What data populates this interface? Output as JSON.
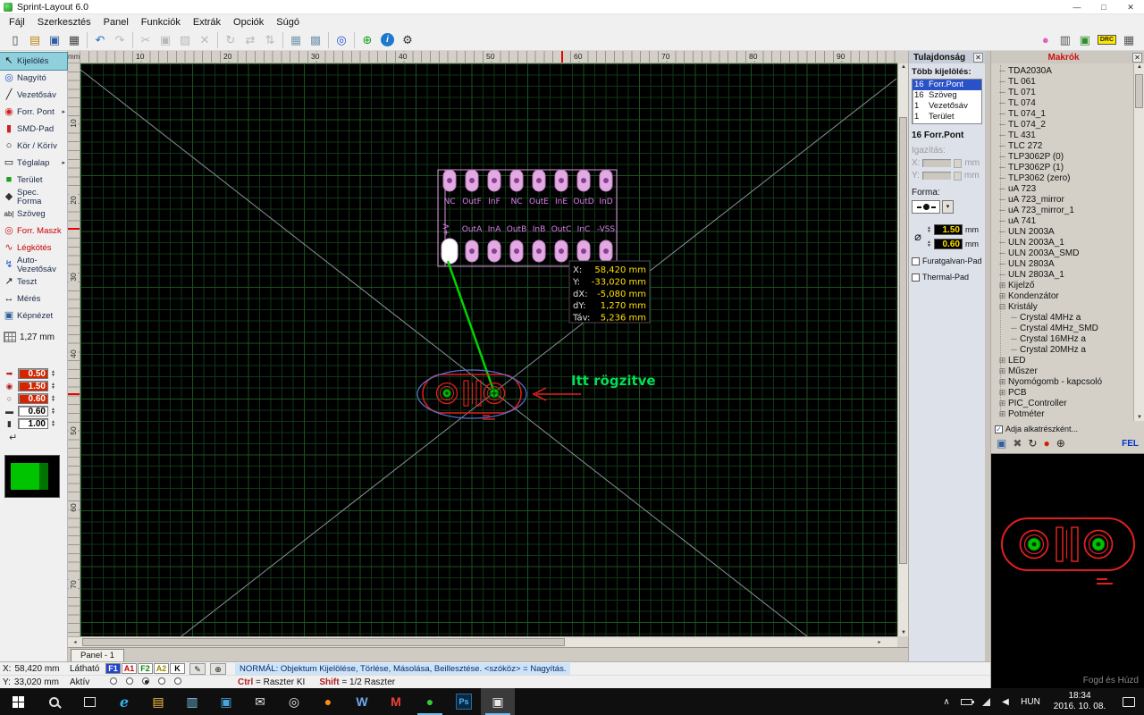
{
  "window": {
    "title": "Sprint-Layout 6.0",
    "minimize_glyph": "—",
    "maximize_glyph": "□",
    "close_glyph": "✕"
  },
  "menubar": [
    "Fájl",
    "Szerkesztés",
    "Panel",
    "Funkciók",
    "Extrák",
    "Opciók",
    "Súgó"
  ],
  "toolbar": {
    "left": [
      {
        "name": "new-file-icon",
        "glyph": "▯",
        "color": "#444444"
      },
      {
        "name": "open-folder-icon",
        "glyph": "▤",
        "color": "#c08a1a"
      },
      {
        "name": "save-icon",
        "glyph": "▣",
        "color": "#2f5fa0"
      },
      {
        "name": "print-icon",
        "glyph": "▦",
        "color": "#444444"
      },
      {
        "sep": true
      },
      {
        "name": "undo-icon",
        "glyph": "↶",
        "color": "#2a6fbd"
      },
      {
        "name": "redo-icon",
        "glyph": "↷",
        "color": "#b8b8b8"
      },
      {
        "sep": true
      },
      {
        "name": "cut-icon",
        "glyph": "✂",
        "color": "#b8b8b8"
      },
      {
        "name": "copy-icon",
        "glyph": "▣",
        "color": "#b8b8b8"
      },
      {
        "name": "paste-icon",
        "glyph": "▨",
        "color": "#b8b8b8"
      },
      {
        "name": "delete-icon",
        "glyph": "✕",
        "color": "#b8b8b8"
      },
      {
        "sep": true
      },
      {
        "name": "rotate-icon",
        "glyph": "↻",
        "color": "#b8b8b8"
      },
      {
        "name": "mirror-horizontal-icon",
        "glyph": "⇄",
        "color": "#b8b8b8"
      },
      {
        "name": "mirror-vertical-icon",
        "glyph": "⇅",
        "color": "#b8b8b8"
      },
      {
        "sep": true
      },
      {
        "name": "align-grid-icon",
        "glyph": "▦",
        "color": "#7a9ab0"
      },
      {
        "name": "snap-grid-icon",
        "glyph": "▩",
        "color": "#7a9ab0"
      },
      {
        "sep": true
      },
      {
        "name": "zoom-icon",
        "glyph": "◎",
        "color": "#2255cc"
      },
      {
        "sep": true
      },
      {
        "name": "crosshair-icon",
        "glyph": "⊕",
        "color": "#18a018"
      },
      {
        "name": "info-icon",
        "glyph": "i",
        "info": true
      },
      {
        "name": "gear-icon",
        "glyph": "⚙",
        "color": "#333333"
      }
    ],
    "right": [
      {
        "name": "hotkeys-icon",
        "glyph": "●",
        "color": "#e060c0"
      },
      {
        "name": "layer-pair-icon",
        "glyph": "▥",
        "color": "#555555"
      },
      {
        "name": "photo-view-icon",
        "glyph": "▣",
        "color": "#2f8f2f"
      },
      {
        "name": "drc-icon",
        "glyph": "DRC",
        "text": true
      },
      {
        "name": "components-icon",
        "glyph": "▦",
        "color": "#555555"
      }
    ]
  },
  "tools": {
    "items": [
      {
        "name": "select",
        "icon": "↖",
        "icon_color": "#111111",
        "label": "Kijelölés",
        "selected": true
      },
      {
        "name": "zoom",
        "icon": "◎",
        "icon_color": "#2255cc",
        "label": "Nagyító"
      },
      {
        "name": "track",
        "icon": "╱",
        "icon_color": "#111111",
        "label": "Vezetősáv"
      },
      {
        "name": "solder-pad",
        "icon": "◉",
        "icon_color": "#cc2222",
        "label": "Forr. Pont",
        "arrow": true
      },
      {
        "name": "smd-pad",
        "icon": "▮",
        "icon_color": "#cc2222",
        "label": "SMD-Pad"
      },
      {
        "name": "circle",
        "icon": "○",
        "icon_color": "#111111",
        "label": "Kör / Körív"
      },
      {
        "name": "rectangle",
        "icon": "▭",
        "icon_color": "#111111",
        "label": "Téglalap",
        "arrow": true
      },
      {
        "name": "area",
        "icon": "■",
        "icon_color": "#18a018",
        "label": "Terület"
      },
      {
        "name": "special-shape",
        "icon": "◆",
        "icon_color": "#333333",
        "label": "Spec. Forma"
      },
      {
        "name": "text",
        "icon": "ab|",
        "icon_color": "#111111",
        "label": "Szöveg",
        "small_icon": true
      },
      {
        "name": "solder-mask",
        "icon": "◎",
        "icon_color": "#cc2222",
        "label": "Forr. Maszk",
        "label_color": "#cc0000"
      },
      {
        "name": "airwire",
        "icon": "∿",
        "icon_color": "#cc2222",
        "label": "Légkötés",
        "label_color": "#cc0000"
      },
      {
        "name": "autoroute",
        "icon": "↯",
        "icon_color": "#2255cc",
        "label": "Auto-Vezetősáv"
      },
      {
        "name": "test",
        "icon": "↗",
        "icon_color": "#111111",
        "label": "Teszt"
      },
      {
        "name": "measure",
        "icon": "↔",
        "icon_color": "#111111",
        "label": "Mérés"
      },
      {
        "name": "photoview",
        "icon": "▣",
        "icon_color": "#2f5fa0",
        "label": "Képnézet"
      }
    ],
    "grid_value": "1,27 mm",
    "fields": [
      {
        "name": "track-width",
        "icon": "➡",
        "icon_color": "#b02020",
        "value": "0.50",
        "red": true
      },
      {
        "name": "pad-outer",
        "icon": "◉",
        "icon_color": "#b02020",
        "value": "1.50",
        "red": true
      },
      {
        "name": "pad-drill",
        "icon": "○",
        "icon_color": "#b02020",
        "value": "0.60",
        "red": true
      },
      {
        "name": "smd-width",
        "icon": "▬",
        "icon_color": "#333333",
        "value": "0.60",
        "red": false
      },
      {
        "name": "smd-height",
        "icon": "▮",
        "icon_color": "#333333",
        "value": "1.00",
        "red": false
      }
    ],
    "return_glyph": "↵"
  },
  "rulers": {
    "unit": "mm",
    "top": [
      "10",
      "20",
      "30",
      "40",
      "50",
      "60",
      "70",
      "80",
      "90"
    ],
    "left": [
      "10",
      "20",
      "30",
      "40",
      "50",
      "60",
      "70"
    ]
  },
  "pcb": {
    "top_labels": [
      "NC",
      "OutF",
      "InF",
      "NC",
      "OutE",
      "InE",
      "OutD",
      "InD"
    ],
    "bottom_labels": [
      "+V",
      "OutA",
      "InA",
      "OutB",
      "InB",
      "OutC",
      "InC",
      "-VSS"
    ],
    "annotation": "Itt rögzitve",
    "readout": [
      {
        "label": "X:",
        "value": "58,420 mm"
      },
      {
        "label": "Y:",
        "value": "-33,020 mm"
      },
      {
        "label": "dX:",
        "value": "-5,080 mm"
      },
      {
        "label": "dY:",
        "value": "1,270 mm"
      },
      {
        "label": "Táv:",
        "value": "5,236 mm"
      }
    ]
  },
  "properties": {
    "title": "Tulajdonság",
    "close_glyph": "✕",
    "multi_label": "Több kijelölés:",
    "selection": [
      {
        "count": "16",
        "label": "Forr.Pont",
        "selected": true
      },
      {
        "count": "16",
        "label": "Szöveg"
      },
      {
        "count": "1",
        "label": "Vezetősáv"
      },
      {
        "count": "1",
        "label": "Terület"
      }
    ],
    "subtitle": "16 Forr.Pont",
    "align_label": "Igazítás:",
    "x_label": "X:",
    "y_label": "Y:",
    "unit": "mm",
    "shape_label": "Forma:",
    "pad_icon_glyph": "⌀",
    "outer_value": "1.50",
    "drill_value": "0.60",
    "checkbox_plated": "Furatgalvan-Pad",
    "checkbox_thermal": "Thermal-Pad"
  },
  "macros": {
    "title": "Makrók",
    "close_glyph": "✕",
    "check_glyph": "✓",
    "items": [
      {
        "type": "leaf",
        "label": "TDA2030A"
      },
      {
        "type": "leaf",
        "label": "TL 061"
      },
      {
        "type": "leaf",
        "label": "TL 071"
      },
      {
        "type": "leaf",
        "label": "TL 074"
      },
      {
        "type": "leaf",
        "label": "TL 074_1"
      },
      {
        "type": "leaf",
        "label": "TL 074_2"
      },
      {
        "type": "leaf",
        "label": "TL 431"
      },
      {
        "type": "leaf",
        "label": "TLC 272"
      },
      {
        "type": "leaf",
        "label": "TLP3062P (0)"
      },
      {
        "type": "leaf",
        "label": "TLP3062P (1)"
      },
      {
        "type": "leaf",
        "label": "TLP3062 (zero)"
      },
      {
        "type": "leaf",
        "label": "uA 723"
      },
      {
        "type": "leaf",
        "label": "uA 723_mirror"
      },
      {
        "type": "leaf",
        "label": "uA 723_mirror_1"
      },
      {
        "type": "leaf",
        "label": "uA 741"
      },
      {
        "type": "leaf",
        "label": "ULN 2003A"
      },
      {
        "type": "leaf",
        "label": "ULN 2003A_1"
      },
      {
        "type": "leaf",
        "label": "ULN 2003A_SMD"
      },
      {
        "type": "leaf",
        "label": "ULN 2803A"
      },
      {
        "type": "leaf",
        "label": "ULN 2803A_1"
      },
      {
        "type": "group",
        "open": false,
        "label": "Kijelző"
      },
      {
        "type": "group",
        "open": false,
        "label": "Kondenzátor"
      },
      {
        "type": "group",
        "open": true,
        "label": "Kristály"
      },
      {
        "type": "child",
        "label": "Crystal 4MHz a"
      },
      {
        "type": "child",
        "label": "Crystal 4MHz_SMD"
      },
      {
        "type": "child",
        "label": "Crystal 16MHz a"
      },
      {
        "type": "child",
        "label": "Crystal 20MHz a"
      },
      {
        "type": "group",
        "open": false,
        "label": "LED"
      },
      {
        "type": "group",
        "open": false,
        "label": "Műszer"
      },
      {
        "type": "group",
        "open": false,
        "label": "Nyomógomb - kapcsoló"
      },
      {
        "type": "group",
        "open": false,
        "label": "PCB"
      },
      {
        "type": "group",
        "open": false,
        "label": "PIC_Controller"
      },
      {
        "type": "group",
        "open": false,
        "label": "Potméter"
      }
    ],
    "icons": [
      {
        "name": "save-macro-icon",
        "glyph": "▣",
        "color": "#2f5fa0"
      },
      {
        "name": "delete-macro-icon",
        "glyph": "✖",
        "color": "#555555"
      },
      {
        "name": "refresh-macros-icon",
        "glyph": "↻",
        "color": "#222222"
      },
      {
        "name": "record-macro-icon",
        "glyph": "●",
        "color": "#cc2200"
      },
      {
        "name": "zoom-macro-icon",
        "glyph": "⊕",
        "color": "#222222"
      }
    ],
    "footer_checkbox": "Adja alkatrészként...",
    "fel_label": "FEL",
    "drag_hint": "Fogd és Húzd"
  },
  "status": {
    "panel_tab": "Panel - 1",
    "x": "X:",
    "x_value": "58,420 mm",
    "y": "Y:",
    "y_value": "33,020 mm",
    "visible_label": "Látható",
    "active_label": "Aktív",
    "layers": [
      {
        "label": "F1",
        "fg": "#ffffff",
        "bg": "#2244cc"
      },
      {
        "label": "A1",
        "fg": "#cc0000",
        "bg": "#ffffff"
      },
      {
        "label": "F2",
        "fg": "#008800",
        "bg": "#ffffff"
      },
      {
        "label": "A2",
        "fg": "#998800",
        "bg": "#ffffff"
      },
      {
        "label": "K",
        "fg": "#000000",
        "bg": "#ffffff"
      }
    ],
    "active_layer_index": 2,
    "buttons": [
      {
        "name": "layer-edit-button",
        "glyph": "✎"
      },
      {
        "name": "grid-menu-button",
        "glyph": "⊕"
      }
    ],
    "mode_text": "NORMÁL: Objektum Kijelölése, Törlése, Másolása, Beillesztése. <szóköz> = Nagyítás.",
    "ctrl_key": "Ctrl",
    "ctrl_text": "= Raszter KI",
    "shift_key": "Shift",
    "shift_text": "= 1/2 Raszter"
  },
  "taskbar": {
    "apps": [
      {
        "name": "edge",
        "glyph": "e",
        "fg": "#35b1e4",
        "edge": true
      },
      {
        "name": "file-explorer",
        "glyph": "▤",
        "fg": "#f4c542"
      },
      {
        "name": "store",
        "glyph": "▥",
        "fg": "#7ec7e8"
      },
      {
        "name": "photos",
        "glyph": "▣",
        "fg": "#4aa3e0"
      },
      {
        "name": "mail",
        "glyph": "✉",
        "fg": "#e8e8e8"
      },
      {
        "name": "browser",
        "glyph": "◎",
        "fg": "#e8e8e8"
      },
      {
        "name": "firefox",
        "glyph": "●",
        "fg": "#ff8c1a"
      },
      {
        "name": "word",
        "glyph": "W",
        "fg": "#6fa8e8",
        "bold": true
      },
      {
        "name": "gmail",
        "glyph": "M",
        "fg": "#ea4335",
        "bold": true
      },
      {
        "name": "sprint-layout",
        "glyph": "●",
        "fg": "#33cc33",
        "running": true
      },
      {
        "name": "photoshop",
        "glyph": "Ps",
        "box": true
      },
      {
        "name": "screenshot-tool",
        "glyph": "▣",
        "fg": "#e8e8e8",
        "active": true
      }
    ],
    "tray": [
      {
        "name": "hidden-icons-icon",
        "glyph": "∧"
      },
      {
        "name": "battery-icon",
        "css": "batt"
      },
      {
        "name": "network-icon",
        "css": "wifi"
      },
      {
        "name": "volume-icon",
        "glyph": "◀"
      }
    ],
    "lang": "HUN",
    "time": "18:34",
    "date": "2016. 10. 08."
  }
}
